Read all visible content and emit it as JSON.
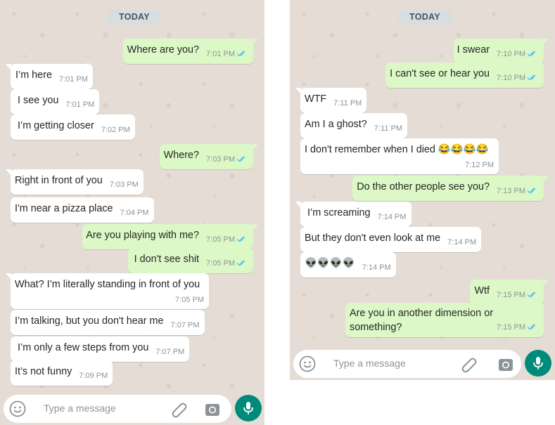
{
  "left": {
    "day_label": "TODAY",
    "messages": [
      {
        "text": "Where are you?",
        "time": "7:01 PM",
        "dir": "out"
      },
      {
        "text": "I’m here",
        "time": "7:01 PM",
        "dir": "in"
      },
      {
        "text": "I see you",
        "time": "7:01 PM",
        "dir": "in"
      },
      {
        "text": "I’m getting closer",
        "time": "7:02 PM",
        "dir": "in"
      },
      {
        "text": "Where?",
        "time": "7:03 PM",
        "dir": "out"
      },
      {
        "text": "Right in front of you",
        "time": "7:03 PM",
        "dir": "in"
      },
      {
        "text": "I'm near a pizza place",
        "time": "7:04 PM",
        "dir": "in"
      },
      {
        "text": "Are you playing with me?",
        "time": "7:05 PM",
        "dir": "out"
      },
      {
        "text": "I don't see shit",
        "time": "7:05 PM",
        "dir": "out"
      },
      {
        "text": "What? I’m literally standing in front of you",
        "time": "7:05 PM",
        "dir": "in"
      },
      {
        "text": "I’m talking, but you don't hear me",
        "time": "7:07 PM",
        "dir": "in"
      },
      {
        "text": "I’m only a few steps from you",
        "time": "7:07 PM",
        "dir": "in"
      },
      {
        "text": "It’s not funny",
        "time": "7:09 PM",
        "dir": "in"
      }
    ],
    "composer": {
      "placeholder": "Type a message"
    }
  },
  "right": {
    "day_label": "TODAY",
    "messages": [
      {
        "text": "I swear",
        "time": "7:10 PM",
        "dir": "out"
      },
      {
        "text": "I can't see or hear you",
        "time": "7:10 PM",
        "dir": "out"
      },
      {
        "text": "WTF",
        "time": "7:11 PM",
        "dir": "in"
      },
      {
        "text": "Am I a ghost?",
        "time": "7:11 PM",
        "dir": "in"
      },
      {
        "text": "I don't remember when I died 😂😂😂😂",
        "time": "7:12 PM",
        "dir": "in"
      },
      {
        "text": "Do the other people see you?",
        "time": "7:13 PM",
        "dir": "out"
      },
      {
        "text": "I’m screaming",
        "time": "7:14 PM",
        "dir": "in"
      },
      {
        "text": "But they don't even look at me",
        "time": "7:14 PM",
        "dir": "in"
      },
      {
        "text": "👽👽👽👽",
        "time": "7:14 PM",
        "dir": "in"
      },
      {
        "text": "Wtf",
        "time": "7:15 PM",
        "dir": "out"
      },
      {
        "text": "Are you in another dimension or something?",
        "time": "7:15 PM",
        "dir": "out"
      }
    ],
    "composer": {
      "placeholder": "Type a message"
    }
  },
  "colors": {
    "chat_bg": "#e5ddd5",
    "incoming_bubble": "#ffffff",
    "outgoing_bubble": "#dcf8c6",
    "read_ticks": "#4fc3f7",
    "mic_button": "#008a7c"
  },
  "icons": [
    "emoji-icon",
    "attach-icon",
    "camera-icon",
    "mic-icon",
    "double-check-icon"
  ]
}
